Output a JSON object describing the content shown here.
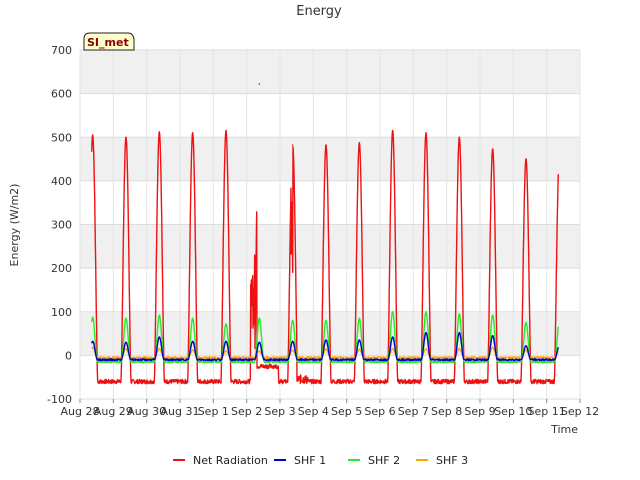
{
  "chart_data": {
    "type": "line",
    "title": "Energy",
    "xlabel": "Time",
    "ylabel": "Energy (W/m2)",
    "badge": "SI_met",
    "ylim": [
      -100,
      700
    ],
    "yticks": [
      -100,
      0,
      100,
      200,
      300,
      400,
      500,
      600,
      700
    ],
    "xlim": [
      0,
      15
    ],
    "xtick_labels": [
      "Aug 28",
      "Aug 29",
      "Aug 30",
      "Aug 31",
      "Sep 1",
      "Sep 2",
      "Sep 3",
      "Sep 4",
      "Sep 5",
      "Sep 6",
      "Sep 7",
      "Sep 8",
      "Sep 9",
      "Sep 10",
      "Sep 11",
      "Sep 12"
    ],
    "grid": true,
    "bands": "alternating grey horizontal bands",
    "legend_position": "bottom",
    "series": [
      {
        "name": "Net Radiation",
        "color": "#ee1111",
        "daily_peak": [
          505,
          500,
          512,
          510,
          515,
          622,
          482,
          482,
          487,
          515,
          510,
          500,
          473,
          450
        ],
        "night_value": -60,
        "spike_notes": "Sep 2: erratic spikes 350-515 then drop; Sep 3: peak 622 with dip to ~190"
      },
      {
        "name": "SHF 1",
        "color": "#0000cc",
        "daily_peak": [
          32,
          30,
          42,
          32,
          32,
          30,
          32,
          35,
          35,
          42,
          52,
          52,
          45,
          22
        ],
        "night_value": -10
      },
      {
        "name": "SHF 2",
        "color": "#22ee22",
        "daily_peak": [
          87,
          85,
          92,
          85,
          72,
          85,
          80,
          80,
          85,
          100,
          100,
          95,
          92,
          75
        ],
        "night_value": -15
      },
      {
        "name": "SHF 3",
        "color": "#ffa500",
        "daily_peak": [
          18,
          15,
          15,
          12,
          10,
          10,
          12,
          14,
          14,
          15,
          15,
          15,
          18,
          12
        ],
        "night_value": -5
      }
    ]
  }
}
